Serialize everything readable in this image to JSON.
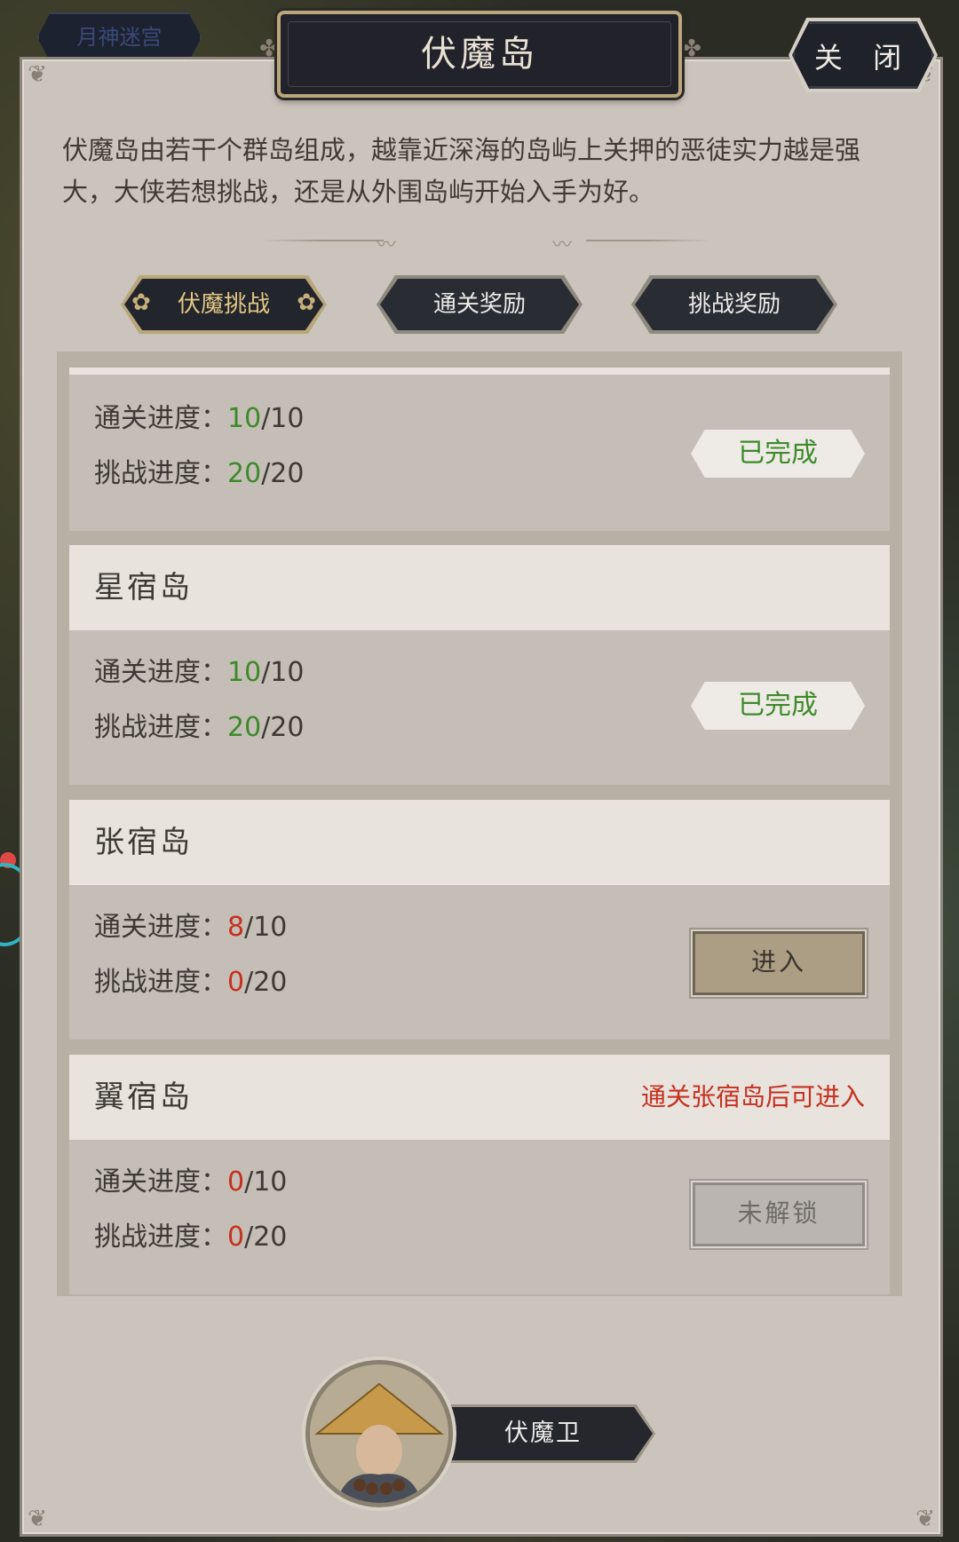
{
  "top_tag": "月神迷宫",
  "title": "伏魔岛",
  "close_label": "关 闭",
  "description": "伏魔岛由若干个群岛组成，越靠近深海的岛屿上关押的恶徒实力越是强大，大侠若想挑战，还是从外围岛屿开始入手为好。",
  "tabs": [
    {
      "label": "伏魔挑战",
      "active": true
    },
    {
      "label": "通关奖励",
      "active": false
    },
    {
      "label": "挑战奖励",
      "active": false
    }
  ],
  "labels": {
    "clear_progress": "通关进度：",
    "challenge_progress": "挑战进度："
  },
  "islands": [
    {
      "name": "",
      "clear_done": "10",
      "clear_total": "/10",
      "challenge_done": "20",
      "challenge_total": "/20",
      "status": "已完成",
      "status_type": "done"
    },
    {
      "name": "星宿岛",
      "clear_done": "10",
      "clear_total": "/10",
      "challenge_done": "20",
      "challenge_total": "/20",
      "status": "已完成",
      "status_type": "done"
    },
    {
      "name": "张宿岛",
      "clear_done": "8",
      "clear_total": "/10",
      "challenge_done": "0",
      "challenge_total": "/20",
      "status": "进入",
      "status_type": "enter"
    },
    {
      "name": "翼宿岛",
      "lock_hint": "通关张宿岛后可进入",
      "clear_done": "0",
      "clear_total": "/10",
      "challenge_done": "0",
      "challenge_total": "/20",
      "status": "未解锁",
      "status_type": "locked"
    }
  ],
  "npc": {
    "name": "伏魔卫",
    "icon": "monk-avatar"
  },
  "colors": {
    "complete": "#3d8a2b",
    "incomplete": "#c6301f",
    "panel": "#cbc4bc",
    "title_plate": "#22222a",
    "gold_trim": "#bca77b"
  }
}
